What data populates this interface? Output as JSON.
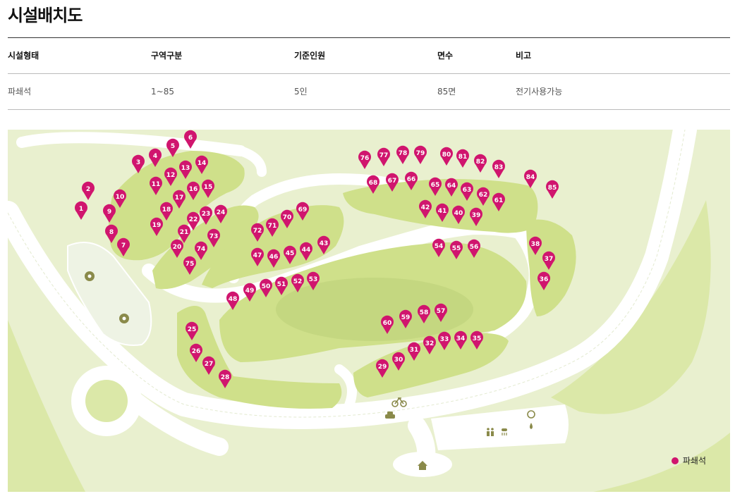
{
  "page": {
    "title": "시설배치도"
  },
  "table": {
    "headers": [
      "시설형태",
      "구역구분",
      "기준인원",
      "면수",
      "비고"
    ],
    "rows": [
      [
        "파쇄석",
        "1~85",
        "5인",
        "85면",
        "전기사용가능"
      ]
    ]
  },
  "map": {
    "legend_label": "파쇄석",
    "colors": {
      "pin": "#d0156e",
      "zone": "#cfe08a",
      "zone_dark": "#bcd07a",
      "road": "#ffffff",
      "ground": "#e9f0cf",
      "grass": "#dbe8a8",
      "facility_icon": "#8a8a4a"
    },
    "icons": [
      "soccer-icon",
      "soccer-icon",
      "bicycle-icon",
      "car-icon",
      "home-icon",
      "restroom-icon",
      "shower-icon",
      "recycle-icon",
      "water-drop-icon"
    ],
    "sites": [
      "1",
      "2",
      "3",
      "4",
      "5",
      "6",
      "7",
      "8",
      "9",
      "10",
      "11",
      "12",
      "13",
      "14",
      "15",
      "16",
      "17",
      "18",
      "19",
      "20",
      "21",
      "22",
      "23",
      "24",
      "25",
      "26",
      "27",
      "28",
      "29",
      "30",
      "31",
      "32",
      "33",
      "34",
      "35",
      "36",
      "37",
      "38",
      "39",
      "40",
      "41",
      "42",
      "43",
      "44",
      "45",
      "46",
      "47",
      "48",
      "49",
      "50",
      "51",
      "52",
      "53",
      "54",
      "55",
      "56",
      "57",
      "58",
      "59",
      "60",
      "61",
      "62",
      "63",
      "64",
      "65",
      "66",
      "67",
      "68",
      "69",
      "70",
      "71",
      "72",
      "73",
      "74",
      "75",
      "76",
      "77",
      "78",
      "79",
      "80",
      "81",
      "82",
      "83",
      "84",
      "85"
    ]
  }
}
